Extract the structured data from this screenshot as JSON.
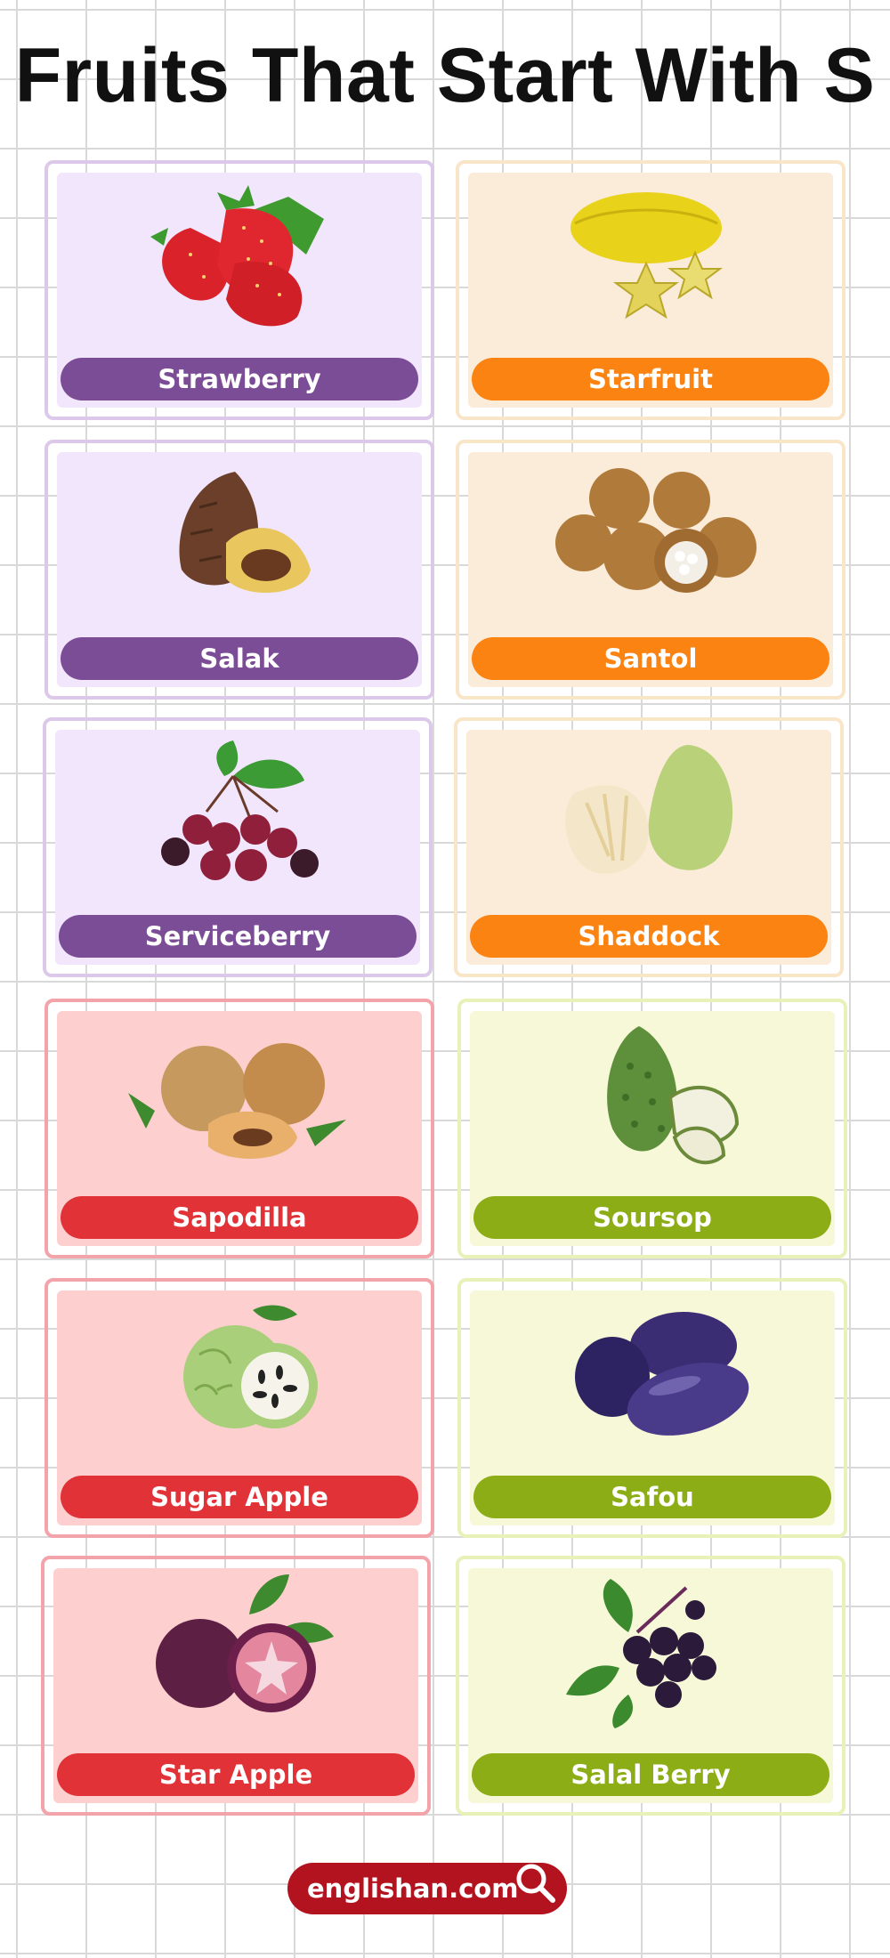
{
  "title": "Fruits That Start With S",
  "cards": [
    {
      "label": "Strawberry",
      "icon": "strawberry-icon"
    },
    {
      "label": "Starfruit",
      "icon": "starfruit-icon"
    },
    {
      "label": "Salak",
      "icon": "salak-icon"
    },
    {
      "label": "Santol",
      "icon": "santol-icon"
    },
    {
      "label": "Serviceberry",
      "icon": "serviceberry-icon"
    },
    {
      "label": "Shaddock",
      "icon": "shaddock-icon"
    },
    {
      "label": "Sapodilla",
      "icon": "sapodilla-icon"
    },
    {
      "label": "Soursop",
      "icon": "soursop-icon"
    },
    {
      "label": "Sugar Apple",
      "icon": "sugar-apple-icon"
    },
    {
      "label": "Safou",
      "icon": "safou-icon"
    },
    {
      "label": "Star Apple",
      "icon": "star-apple-icon"
    },
    {
      "label": "Salal Berry",
      "icon": "salal-berry-icon"
    }
  ],
  "footer": {
    "site": "englishan.com",
    "icon": "magnifier-icon"
  },
  "colors": {
    "purple_label": "#7b4d96",
    "purple_bg": "#f1e6fb",
    "orange_label": "#fb8312",
    "orange_bg": "#fbebd9",
    "red_label": "#e13238",
    "red_bg": "#fdcfcf",
    "green_label": "#8cad16",
    "green_bg": "#f6f8d8",
    "footer_bg": "#b3131f"
  }
}
